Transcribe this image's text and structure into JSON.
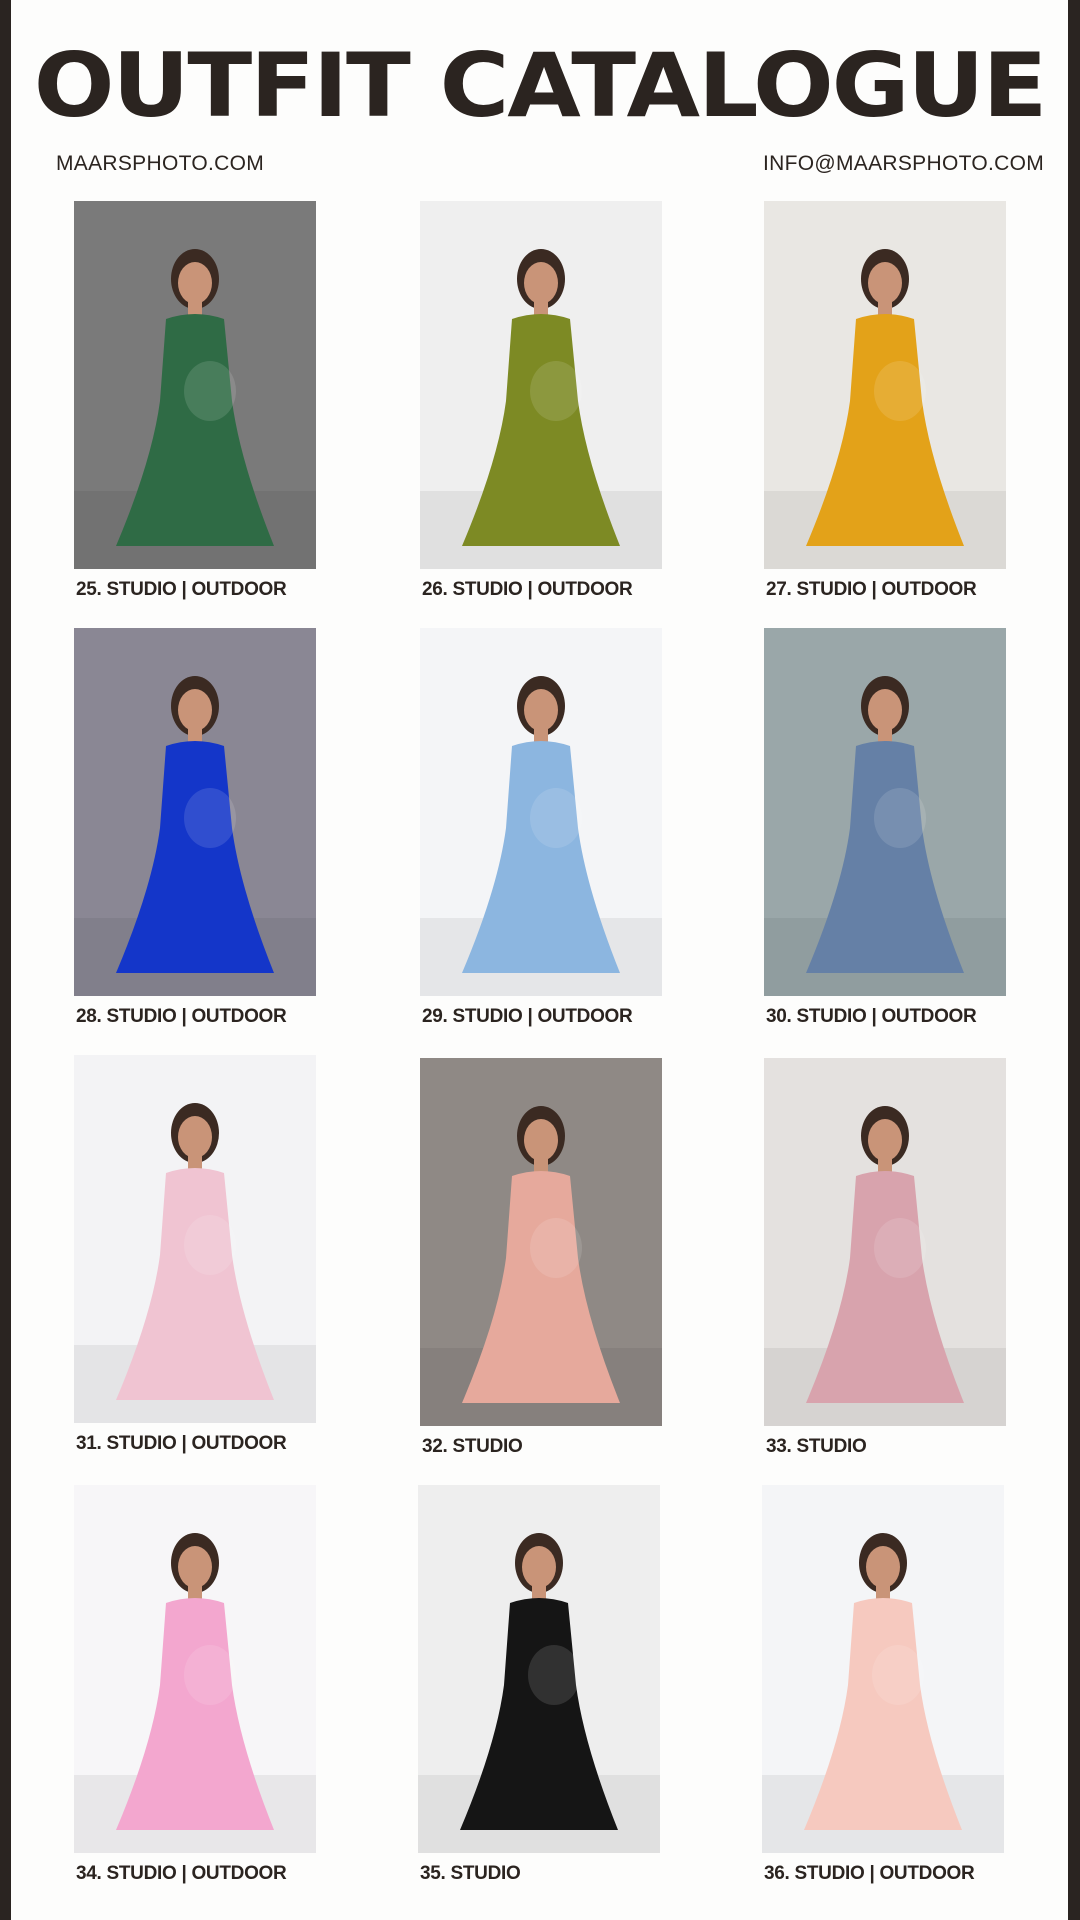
{
  "header": {
    "title": "OUTFIT CATALOGUE",
    "website": "MAARSPHOTO.COM",
    "email": "INFO@MAARSPHOTO.COM"
  },
  "outfits": [
    {
      "caption": "25. STUDIO | OUTDOOR",
      "icon": "photo-green-long-sleeve-gown",
      "bg": "#7a7a7a",
      "dress": "#2f6b45"
    },
    {
      "caption": "26. STUDIO | OUTDOOR",
      "icon": "photo-olive-organza-wrap",
      "bg": "#efefef",
      "dress": "#7d8a24"
    },
    {
      "caption": "27. STUDIO | OUTDOOR",
      "icon": "photo-mustard-tulle-gown",
      "bg": "#e9e7e3",
      "dress": "#e3a219"
    },
    {
      "caption": "28. STUDIO | OUTDOOR",
      "icon": "photo-royal-blue-hooded-dress",
      "bg": "#8a8794",
      "dress": "#1436c9"
    },
    {
      "caption": "29. STUDIO | OUTDOOR",
      "icon": "photo-light-blue-maxi-dress",
      "bg": "#f4f5f7",
      "dress": "#8cb6e0"
    },
    {
      "caption": "30. STUDIO | OUTDOOR",
      "icon": "photo-dusty-blue-tulle-gown",
      "bg": "#9aa7a9",
      "dress": "#6580a6"
    },
    {
      "caption": "31. STUDIO | OUTDOOR",
      "icon": "photo-pink-ruffle-gown",
      "bg": "#f3f3f5",
      "dress": "#f0c4d2"
    },
    {
      "caption": "32. STUDIO",
      "icon": "photo-pink-satin-gown",
      "bg": "#8f8985",
      "dress": "#e6a99c"
    },
    {
      "caption": "33. STUDIO",
      "icon": "photo-mauve-kaftan-dress",
      "bg": "#e4e1df",
      "dress": "#d8a3ad"
    },
    {
      "caption": "34. STUDIO | OUTDOOR",
      "icon": "photo-pink-off-shoulder-train",
      "bg": "#f7f6f8",
      "dress": "#f3a7cf"
    },
    {
      "caption": "35. STUDIO",
      "icon": "photo-black-white-ruffle-dress",
      "bg": "#eeeeee",
      "dress": "#151515"
    },
    {
      "caption": "36. STUDIO | OUTDOOR",
      "icon": "photo-blush-tulle-gown",
      "bg": "#f4f5f7",
      "dress": "#f6c9bf"
    }
  ]
}
